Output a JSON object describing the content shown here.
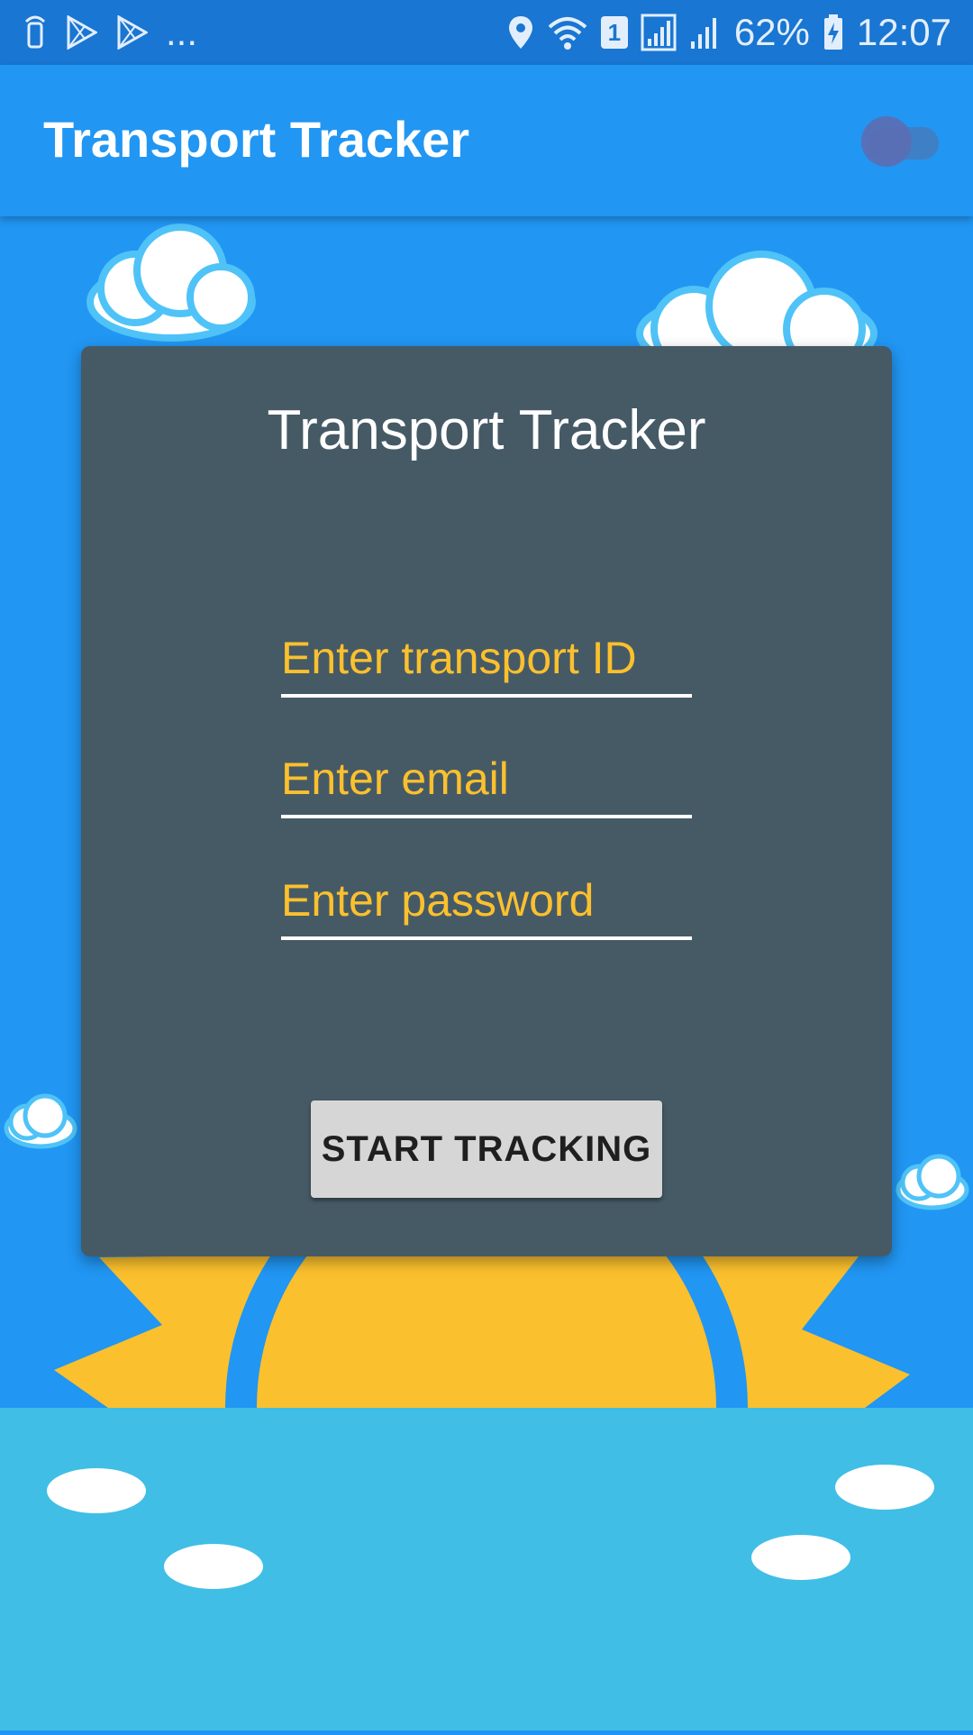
{
  "status_bar": {
    "overflow": "...",
    "battery": "62%",
    "time": "12:07",
    "sim": "1",
    "icons": [
      "nfc-icon",
      "play-store-icon",
      "play-store-icon",
      "location-icon",
      "wifi-icon",
      "sim-icon",
      "signal-icon",
      "signal-icon",
      "battery-charging-icon"
    ]
  },
  "app_bar": {
    "title": "Transport Tracker",
    "toggle_on": false
  },
  "card": {
    "title": "Transport Tracker",
    "fields": {
      "transport_id_placeholder": "Enter transport ID",
      "email_placeholder": "Enter email",
      "password_placeholder": "Enter password"
    },
    "start_button": "START TRACKING"
  },
  "colors": {
    "sky": "#2196f3",
    "status_bar": "#1976d2",
    "card": "#465a66",
    "accent_text": "#fbc02d",
    "sun": "#fbc02d",
    "sea": "#40bee6"
  }
}
